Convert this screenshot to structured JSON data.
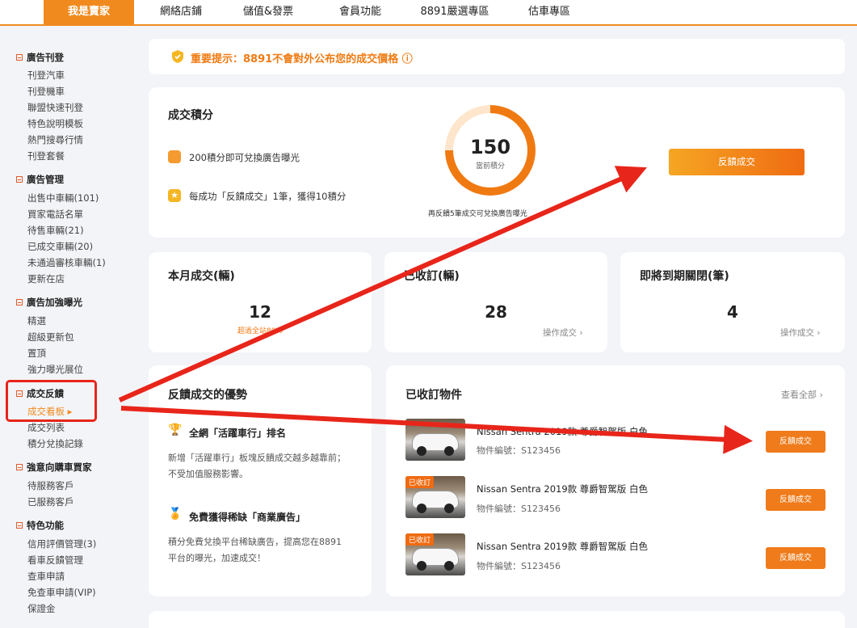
{
  "topnav": {
    "tabs": [
      "我是賣家",
      "網絡店鋪",
      "儲值&發票",
      "會員功能",
      "8891嚴選專區",
      "估車專區"
    ]
  },
  "sidebar": {
    "sections": [
      {
        "title": "廣告刊登",
        "items": [
          "刊登汽車",
          "刊登機車",
          "聯盟快速刊登",
          "特色說明模板",
          "熱門搜尋行情",
          "刊登套餐"
        ]
      },
      {
        "title": "廣告管理",
        "items": [
          "出售中車輛(101)",
          "買家電話名單",
          "待售車輛(21)",
          "已成交車輛(20)",
          "未通過審核車輛(1)",
          "更新在店"
        ]
      },
      {
        "title": "廣告加強曝光",
        "items": [
          "精選",
          "超級更新包",
          "置頂",
          "強力曝光展位"
        ]
      },
      {
        "title": "成交反饋",
        "items": [
          "成交看板 ▸",
          "成交列表",
          "積分兌換記錄"
        ]
      },
      {
        "title": "強意向購車買家",
        "items": [
          "待服務客戶",
          "已服務客戶"
        ]
      },
      {
        "title": "特色功能",
        "items": [
          "信用評價管理(3)",
          "看車反饋管理",
          "查車申請",
          "免查車申請(VIP)",
          "保證金"
        ]
      }
    ]
  },
  "notice": {
    "text": "重要提示：8891不會對外公布您的成交價格 ⓘ"
  },
  "score": {
    "title": "成交積分",
    "line1": "200積分即可兌換廣告曝光",
    "line2": "每成功「反饋成交」1筆，獲得10積分",
    "value": "150",
    "value_label": "當前積分",
    "hint": "再反饋5筆成交可兌換廣告曝光",
    "button": "反饋成交",
    "progress": 0.75
  },
  "stats": [
    {
      "title": "本月成交(輛)",
      "value": "12",
      "sub": "超過全站80%"
    },
    {
      "title": "已收訂(輛)",
      "value": "28",
      "link": "操作成交 ›"
    },
    {
      "title": "即將到期關閉(筆)",
      "value": "4",
      "link": "操作成交 ›"
    }
  ],
  "advantages": {
    "title": "反饋成交的優勢",
    "items": [
      {
        "title": "全網「活躍車行」排名",
        "desc": "新增「活躍車行」板塊反饋成交越多越靠前；不受加值服務影響。"
      },
      {
        "title": "免費獲得稀缺「商業廣告」",
        "desc": "積分免費兌換平台稀缺廣告，提高您在8891平台的曝光，加速成交！"
      }
    ]
  },
  "orders": {
    "title": "已收訂物件",
    "view_all": "查看全部 ›",
    "tag": "已收訂",
    "button": "反饋成交",
    "rows": [
      {
        "name": "Nissan Sentra 2019款 尊爵智駕版 白色",
        "no": "物件編號：S123456"
      },
      {
        "name": "Nissan Sentra 2019款 尊爵智駕版 白色",
        "no": "物件編號：S123456"
      },
      {
        "name": "Nissan Sentra 2019款 尊爵智駕版 白色",
        "no": "物件編號：S123456"
      }
    ]
  },
  "colors": {
    "accent": "#f08a1e",
    "annotation": "#e8251a"
  }
}
